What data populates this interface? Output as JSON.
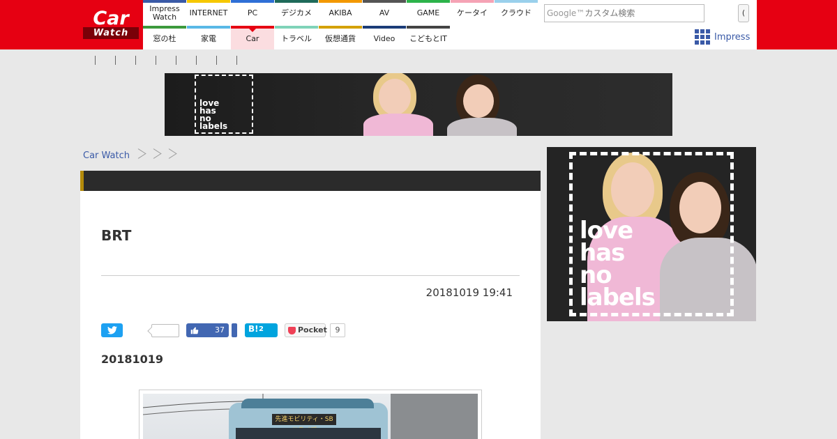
{
  "header": {
    "logo": {
      "top": "Car",
      "bottom": "Watch"
    },
    "nav_row1": [
      {
        "label": "Impress Watch",
        "color": "#3a5aa7"
      },
      {
        "label": "INTERNET",
        "color": "#f6c800"
      },
      {
        "label": "PC",
        "color": "#2f6fd6"
      },
      {
        "label": "デジカメ",
        "color": "#1f6a5a"
      },
      {
        "label": "AKIBA",
        "color": "#f39800"
      },
      {
        "label": "AV",
        "color": "#555555"
      },
      {
        "label": "GAME",
        "color": "#2cb34a"
      },
      {
        "label": "ケータイ",
        "color": "#f5a3b5"
      },
      {
        "label": "クラウド",
        "color": "#9ad0ec"
      }
    ],
    "nav_row2": [
      {
        "label": "窓の杜",
        "color": "#3c9a3c"
      },
      {
        "label": "家電",
        "color": "#59b8e6"
      },
      {
        "label": "Car",
        "color": "#e60012",
        "active": true
      },
      {
        "label": "トラベル",
        "color": "#7fd3b8"
      },
      {
        "label": "仮想通貨",
        "color": "#d4a100"
      },
      {
        "label": "Video",
        "color": "#1b3c78"
      },
      {
        "label": "こどもとIT",
        "color": "#444444"
      }
    ],
    "search": {
      "google_label": "Google™",
      "placeholder": "カスタム検索",
      "button": "("
    },
    "impress_label": "Impress"
  },
  "subnav_count": 8,
  "ads": {
    "banner_text": "love\nhas\nno\nlabels",
    "side_text": "love\nhas\nno\nlabels"
  },
  "breadcrumb": {
    "home": "Car Watch"
  },
  "article": {
    "title": "BRT",
    "date": "20181019 19:41",
    "subhead": "20181019",
    "share": {
      "facebook_count": "37",
      "hatena_label": "B!",
      "hatena_count": "2",
      "pocket_label": "Pocket",
      "pocket_count": "9"
    },
    "photo_sign": "先進モビリティ・SBドライブ"
  }
}
